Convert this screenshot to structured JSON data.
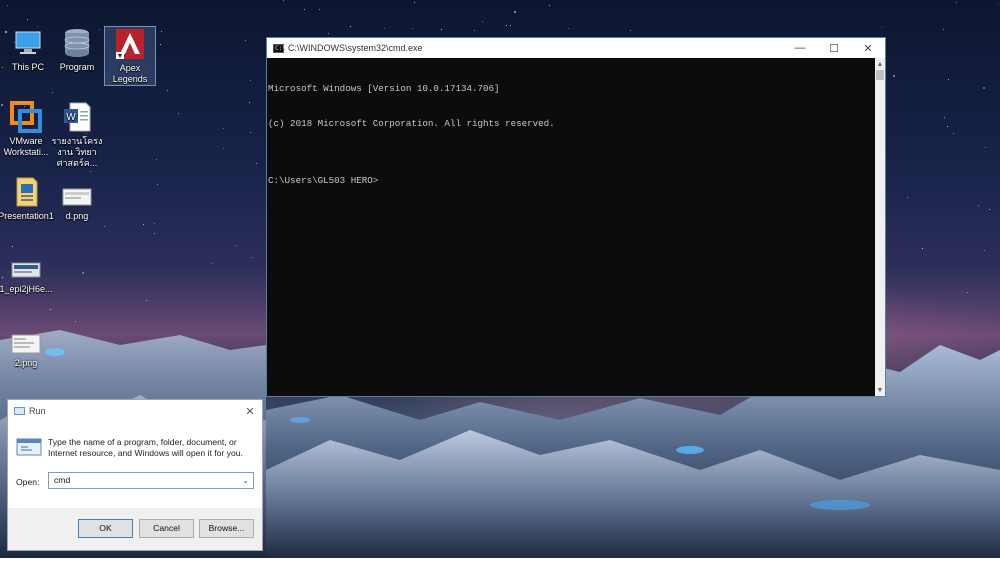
{
  "desktop": {
    "icons": [
      {
        "label": "This PC",
        "icon": "computer-icon"
      },
      {
        "label": "Program",
        "icon": "database-icon"
      },
      {
        "label": "Apex Legends",
        "icon": "apex-legends-icon"
      },
      {
        "label": "VMware Workstati...",
        "icon": "vmware-icon"
      },
      {
        "label": "รายงานโครงงาน วิทยาศาสตร์ค...",
        "icon": "word-document-icon"
      },
      {
        "label": "Presentation1",
        "icon": "powerpoint-icon"
      },
      {
        "label": "d.png",
        "icon": "image-file-icon"
      },
      {
        "label": "1_epi2jH6e...",
        "icon": "image-file-icon"
      },
      {
        "label": "2.png",
        "icon": "image-file-icon"
      }
    ]
  },
  "cmd": {
    "title": "C:\\WINDOWS\\system32\\cmd.exe",
    "icon_text": "C:\\",
    "lines": [
      "Microsoft Windows [Version 10.0.17134.706]",
      "(c) 2018 Microsoft Corporation. All rights reserved.",
      "",
      "C:\\Users\\GL503 HERO>"
    ],
    "controls": {
      "minimize": "—",
      "maximize": "☐",
      "close": "✕"
    }
  },
  "run": {
    "title": "Run",
    "description": "Type the name of a program, folder, document, or Internet resource, and Windows will open it for you.",
    "open_label": "Open:",
    "open_value": "cmd",
    "buttons": {
      "ok": "OK",
      "cancel": "Cancel",
      "browse": "Browse..."
    },
    "close": "✕"
  }
}
